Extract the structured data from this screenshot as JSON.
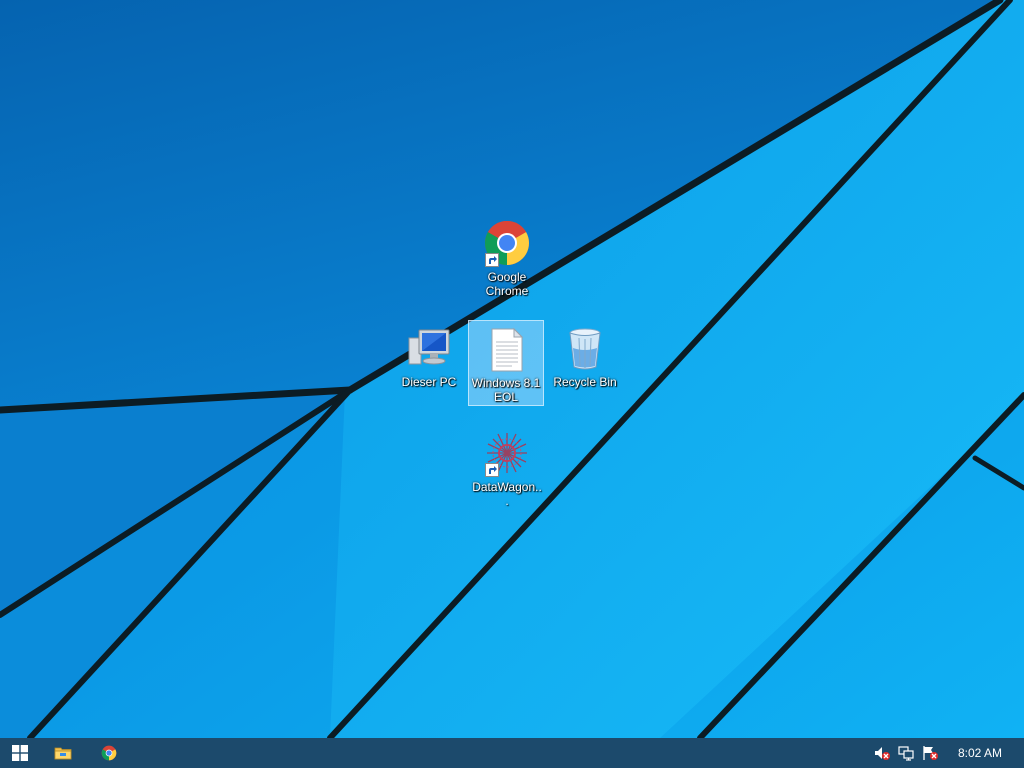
{
  "desktop": {
    "icons": [
      {
        "label": "Google Chrome",
        "icon": "chrome-icon",
        "shortcut": true
      },
      {
        "label": "Dieser PC",
        "icon": "computer-icon",
        "shortcut": false
      },
      {
        "label": "Windows 8.1 EOL",
        "icon": "text-document-icon",
        "shortcut": false,
        "selected": true
      },
      {
        "label": "Recycle Bin",
        "icon": "recycle-bin-icon",
        "shortcut": false
      },
      {
        "label": "DataWagon...",
        "icon": "datawagon-icon",
        "shortcut": true
      }
    ]
  },
  "taskbar": {
    "pinned": [
      "windows-start-icon",
      "file-explorer-icon",
      "chrome-icon"
    ],
    "tray": [
      "volume-muted-icon",
      "network-icon",
      "action-center-icon"
    ],
    "clock": "8:02 AM"
  },
  "colors": {
    "wallpaper_light": "#12b0f2",
    "wallpaper_dark": "#0868b8",
    "taskbar": "#1c4a6c",
    "accent": "#0a8fe0"
  }
}
